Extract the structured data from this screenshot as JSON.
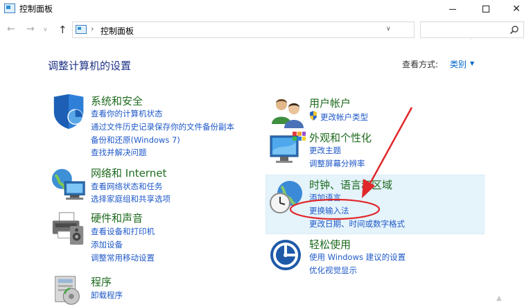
{
  "window": {
    "title": "控制面板",
    "minimize": "—",
    "close": "✕"
  },
  "address": {
    "path": "控制面板",
    "separator": "›",
    "search_placeholder": ""
  },
  "nav": {
    "back": "←",
    "forward": "→",
    "recent": "∨",
    "up": "↑",
    "refresh": "↻",
    "dropdown": "∨"
  },
  "main": {
    "heading": "调整计算机的设置",
    "view_label": "查看方式:",
    "view_value": "类别"
  },
  "categories": {
    "security": {
      "title": "系统和安全",
      "links": [
        "查看你的计算机状态",
        "通过文件历史记录保存你的文件备份副本",
        "备份和还原(Windows 7)",
        "查找并解决问题"
      ],
      "icon": "shield-icon"
    },
    "network": {
      "title": "网络和 Internet",
      "links": [
        "查看网络状态和任务",
        "选择家庭组和共享选项"
      ],
      "icon": "globe-network-icon"
    },
    "hardware": {
      "title": "硬件和声音",
      "links": [
        "查看设备和打印机",
        "添加设备",
        "调整常用移动设置"
      ],
      "icon": "printer-icon"
    },
    "programs": {
      "title": "程序",
      "links": [
        "卸载程序"
      ],
      "icon": "programs-icon"
    },
    "accounts": {
      "title": "用户帐户",
      "links": [
        "更改帐户类型"
      ],
      "icon": "users-icon"
    },
    "appearance": {
      "title": "外观和个性化",
      "links": [
        "更改主题",
        "调整屏幕分辨率"
      ],
      "icon": "monitor-icon"
    },
    "clock": {
      "title": "时钟、语言和区域",
      "links": [
        "添加语言",
        "更换输入法",
        "更改日期、时间或数字格式"
      ],
      "icon": "clock-globe-icon"
    },
    "ease": {
      "title": "轻松使用",
      "links": [
        "使用 Windows 建议的设置",
        "优化视觉显示"
      ],
      "icon": "ease-of-access-icon"
    }
  },
  "colors": {
    "link": "#1f59c8",
    "category_title": "#1e6a1e",
    "heading": "#1e3287",
    "highlight": "#e5f3fb",
    "annotation": "#e0282a"
  },
  "watermark": "▲"
}
